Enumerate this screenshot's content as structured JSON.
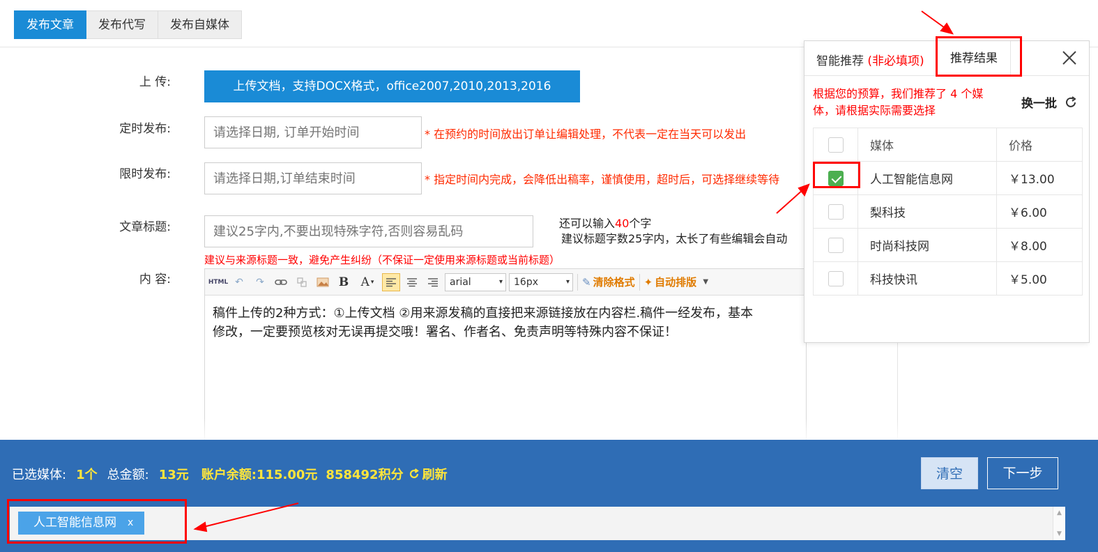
{
  "tabs": [
    {
      "label": "发布文章",
      "active": true
    },
    {
      "label": "发布代写",
      "active": false
    },
    {
      "label": "发布自媒体",
      "active": false
    }
  ],
  "form": {
    "upload_label": "上 传:",
    "upload_button": "上传文档，支持DOCX格式，office2007,2010,2013,2016",
    "schedule_label": "定时发布:",
    "schedule_placeholder": "请选择日期, 订单开始时间",
    "schedule_hint": "* 在预约的时间放出订单让编辑处理，不代表一定在当天可以发出",
    "deadline_label": "限时发布:",
    "deadline_placeholder": "请选择日期,订单结束时间",
    "deadline_hint": "* 指定时间内完成，会降低出稿率，谨慎使用，超时后，可选择继续等待",
    "title_label": "文章标题:",
    "title_placeholder": "建议25字内,不要出现特殊字符,否则容易乱码",
    "title_counter_prefix": "还可以输入",
    "title_counter_num": "40",
    "title_counter_suffix": "个字",
    "title_counter_line2": "建议标题字数25字内，太长了有些编辑会自动",
    "title_hint": "建议与来源标题一致，避免产生纠纷（不保证一定使用来源标题或当前标题）",
    "content_label": "内 容:"
  },
  "editor": {
    "font_name": "arial",
    "font_size": "16px",
    "clear_format": "清除格式",
    "auto_layout": "自动排版",
    "content_line1": "稿件上传的2种方式：①上传文档 ②用来源发稿的直接把来源链接放在内容栏.稿件一经发布，基本",
    "content_line2": "修改，一定要预览核对无误再提交哦！署名、作者名、免责声明等特殊内容不保证！"
  },
  "panel": {
    "tab_smart": "智能推荐",
    "tab_smart_optional": "(非必填项)",
    "tab_result": "推荐结果",
    "recommend_text": "根据您的预算，我们推荐了 4 个媒体，请根据实际需要选择",
    "refresh_batch": "换一批",
    "table_headers": {
      "media": "媒体",
      "price": "价格"
    },
    "rows": [
      {
        "media": "人工智能信息网",
        "price": "￥13.00",
        "checked": true
      },
      {
        "media": "梨科技",
        "price": "￥6.00",
        "checked": false
      },
      {
        "media": "时尚科技网",
        "price": "￥8.00",
        "checked": false
      },
      {
        "media": "科技快讯",
        "price": "￥5.00",
        "checked": false
      }
    ]
  },
  "bottom": {
    "selected_label": "已选媒体:",
    "selected_count": "1个",
    "total_label": "总金额:",
    "total_value": "13元",
    "balance_label": "账户余额:",
    "balance_value": "115.00元",
    "points_value": "858492积分",
    "refresh": "刷新",
    "clear_button": "清空",
    "next_button": "下一步",
    "selected_tag": "人工智能信息网",
    "tag_close": "x"
  },
  "colors": {
    "primary": "#1a8bd6",
    "bottom_bar": "#2f6db5",
    "highlight": "#ffe53b",
    "hint_red": "#ff2a00",
    "annotation_red": "#ff0000",
    "check_green": "#4caf50"
  }
}
